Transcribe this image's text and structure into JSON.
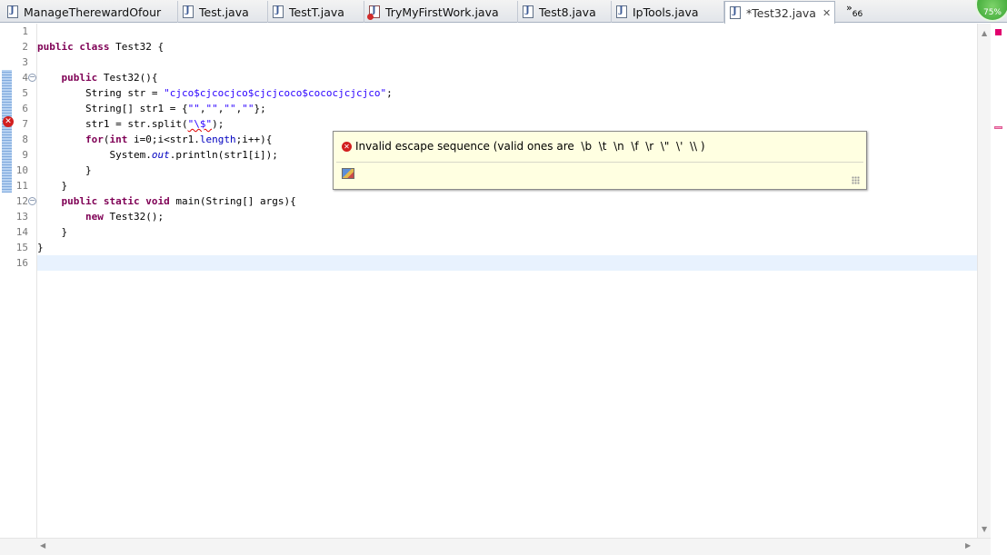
{
  "tabs": [
    {
      "label": "ManageTherewardOfour",
      "icon": "java-file-icon"
    },
    {
      "label": "Test.java",
      "icon": "java-file-icon"
    },
    {
      "label": "TestT.java",
      "icon": "java-file-icon"
    },
    {
      "label": "TryMyFirstWork.java",
      "icon": "java-file-error-icon"
    },
    {
      "label": "Test8.java",
      "icon": "java-file-icon"
    },
    {
      "label": "IpTools.java",
      "icon": "java-file-icon"
    },
    {
      "label": "*Test32.java",
      "icon": "java-file-icon",
      "active": true
    }
  ],
  "tab_overflow": {
    "chevron": "»",
    "count": "66"
  },
  "progress_badge": "75%",
  "line_numbers": [
    "1",
    "2",
    "3",
    "4",
    "5",
    "6",
    "7",
    "8",
    "9",
    "10",
    "11",
    "12",
    "13",
    "14",
    "15",
    "16"
  ],
  "code_lines": [
    "",
    "public class Test32 {",
    "",
    "    public Test32(){",
    "        String str = \"cjco$cjcocjco$cjcjcoco$cococjcjcjco\";",
    "        String[] str1 = {\"\",\"\",\"\",\"\"};",
    "        str1 = str.split(\"\\$\");",
    "        for(int i=0;i<str1.length;i++){",
    "            System.out.println(str1[i]);",
    "        }",
    "    }",
    "    public static void main(String[] args){",
    "        new Test32();",
    "    }",
    "}",
    ""
  ],
  "code_parts": {
    "l2_kw": "public class",
    "l2_rest": " Test32 {",
    "l4_kw": "public",
    "l4_rest": " Test32(){",
    "l5_a": "String str = ",
    "l5_str": "\"cjco$cjcocjco$cjcjcoco$cococjcjcjco\"",
    "l5_b": ";",
    "l6_a": "String[] str1 = {",
    "l6_s1": "\"\"",
    "l6_s2": "\"\"",
    "l6_s3": "\"\"",
    "l6_s4": "\"\"",
    "l6_b": "};",
    "l6_comma": ",",
    "l7_a": "str1 = str.split(",
    "l7_str": "\"\\$\"",
    "l7_b": ");",
    "l8_kw1": "for",
    "l8_a": "(",
    "l8_kw2": "int",
    "l8_b": " i=0;i<str1.",
    "l8_fld": "length",
    "l8_c": ";i++){",
    "l9_a": "System.",
    "l9_fld": "out",
    "l9_b": ".println(str1[i]);",
    "l10": "}",
    "l11": "}",
    "l12_kw": "public static void",
    "l12_rest": " main(String[] args){",
    "l13_kw": "new",
    "l13_rest": " Test32();",
    "l14": "}",
    "l15": "}"
  },
  "hover_popup": {
    "message": "Invalid escape sequence (valid ones are  \\b  \\t  \\n  \\f  \\r  \\\"  \\'  \\\\ )",
    "icon": "error-icon",
    "footer_icon": "configure-hover-icon"
  },
  "error_marker": {
    "line": "7",
    "icon": "error-icon"
  },
  "colors": {
    "keyword": "#7f0055",
    "string": "#2a00ff",
    "field": "#0000c0",
    "current_line": "#e8f2fe",
    "hover_background": "#ffffe1",
    "error": "#d21f1f"
  }
}
